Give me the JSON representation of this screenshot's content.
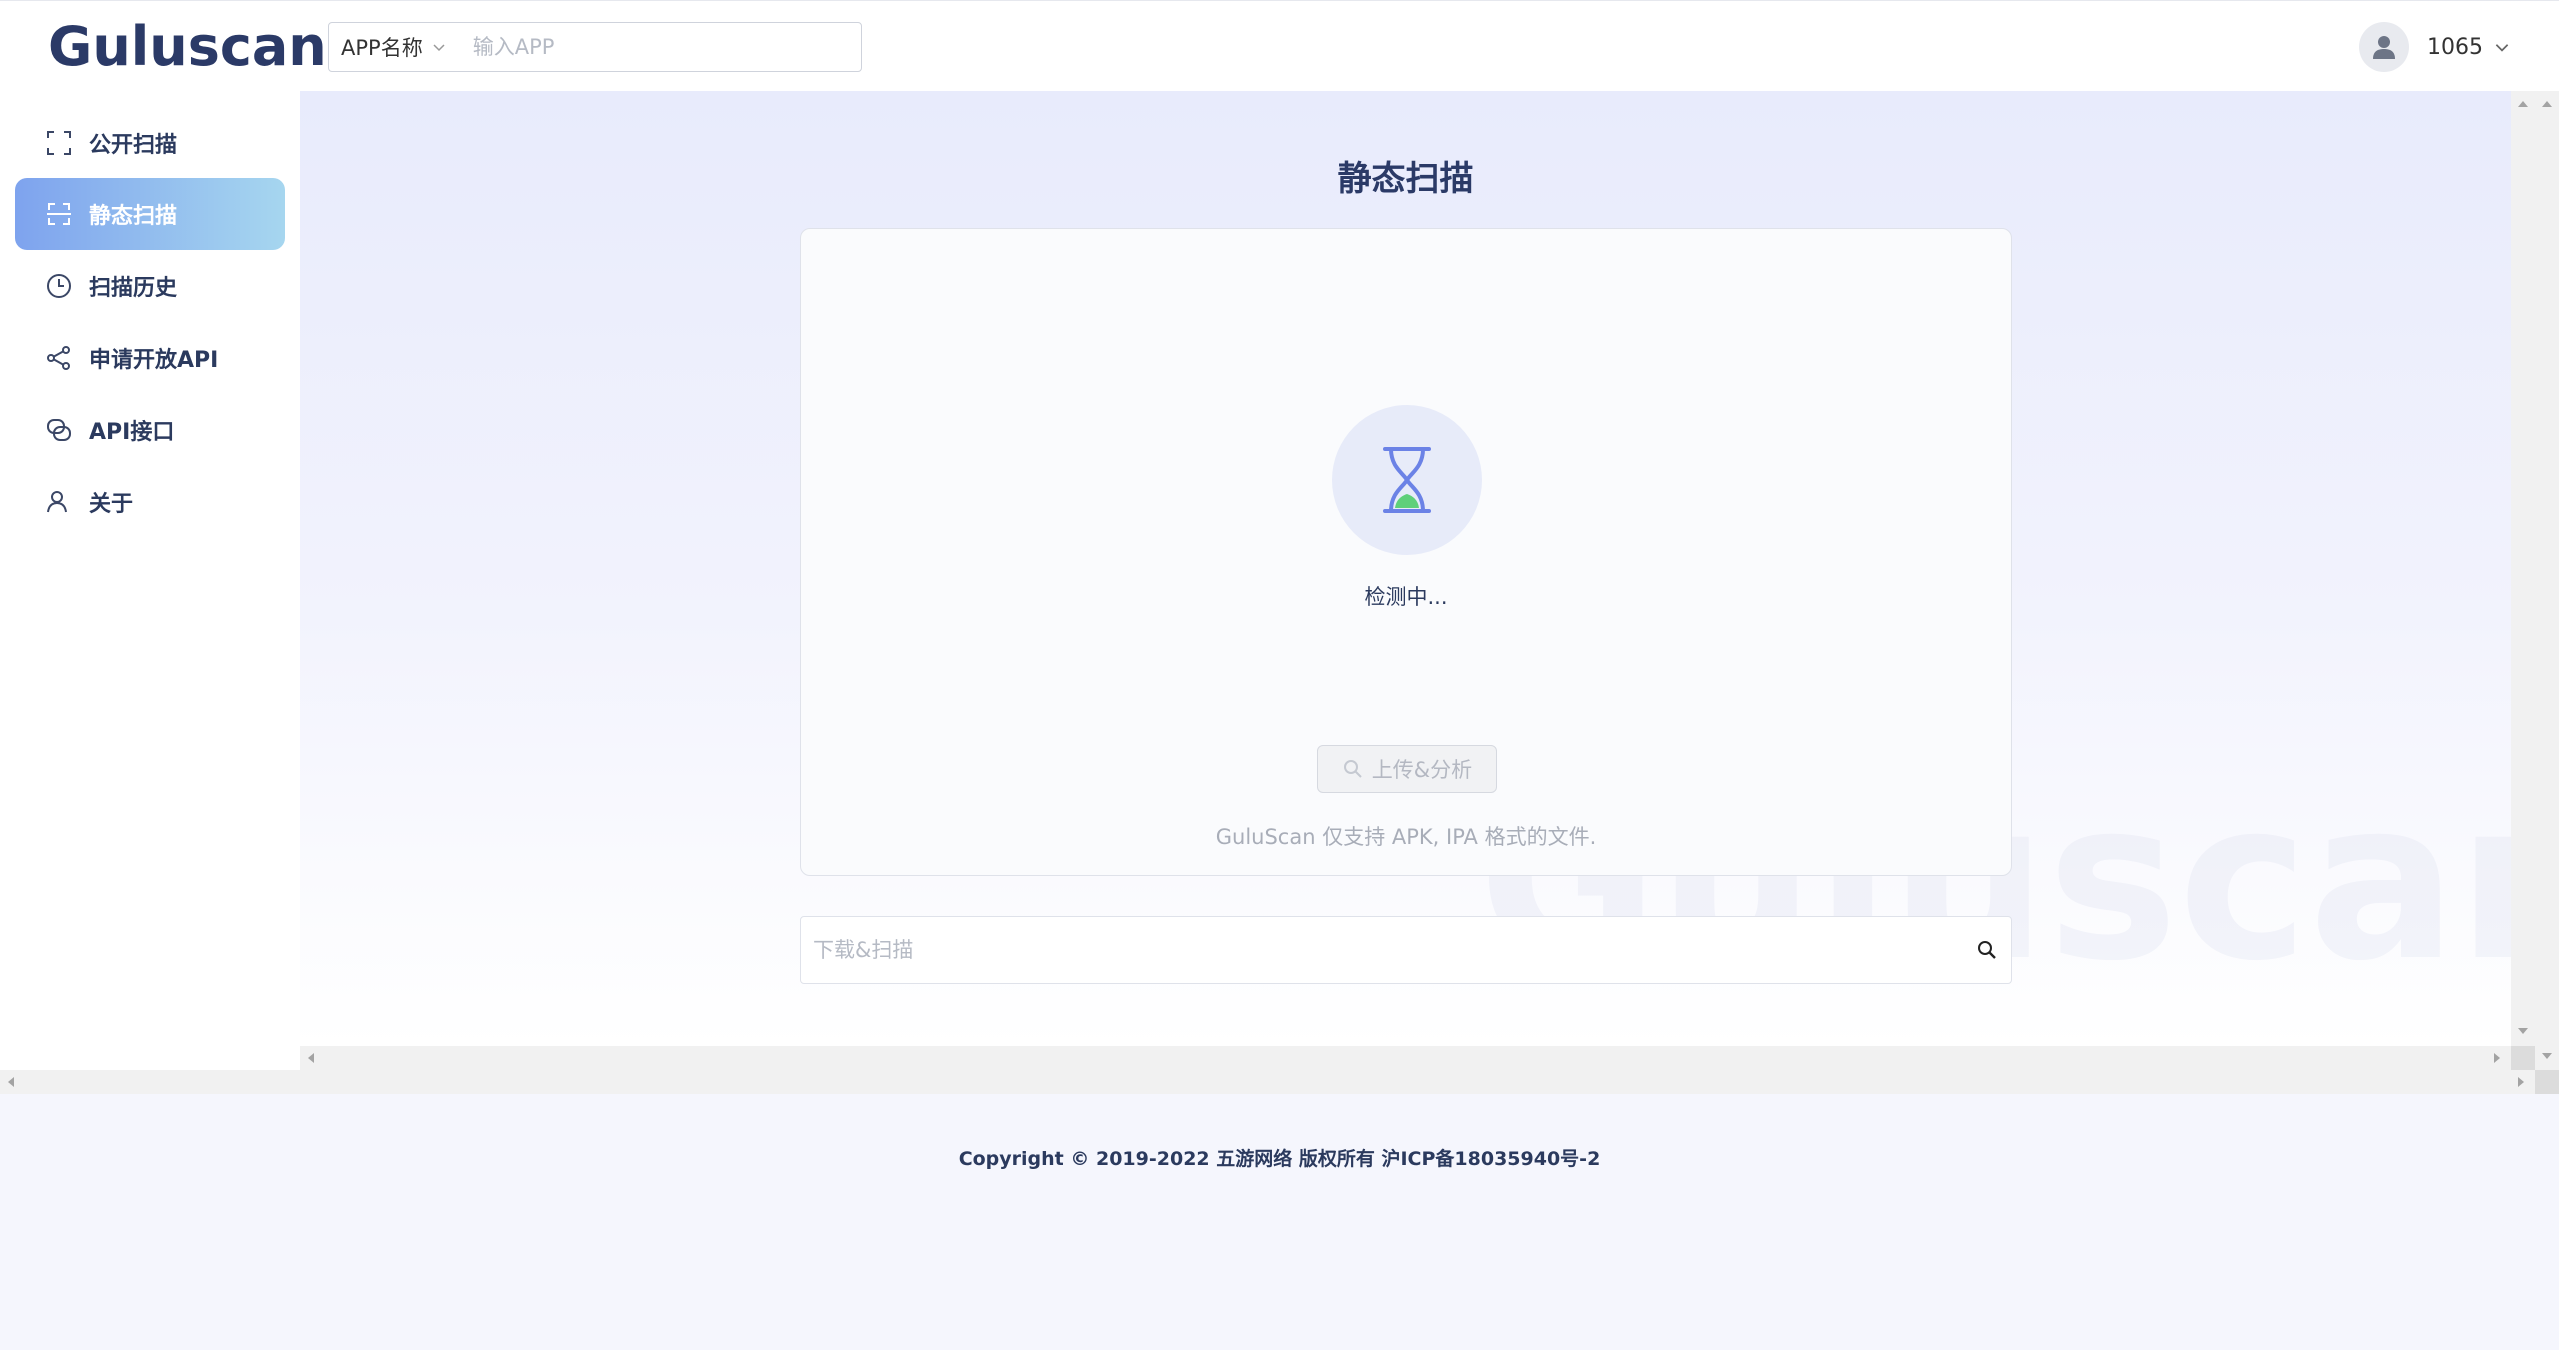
{
  "header": {
    "logo": "Guluscan",
    "search": {
      "type_label": "APP名称",
      "placeholder": "输入APP"
    },
    "user": {
      "name": "1065"
    }
  },
  "sidebar": {
    "items": [
      {
        "label": "公开扫描",
        "icon": "scan-frame-icon",
        "active": false
      },
      {
        "label": "静态扫描",
        "icon": "static-scan-icon",
        "active": true
      },
      {
        "label": "扫描历史",
        "icon": "clock-icon",
        "active": false
      },
      {
        "label": "申请开放API",
        "icon": "share-icon",
        "active": false
      },
      {
        "label": "API接口",
        "icon": "link-icon",
        "active": false
      },
      {
        "label": "关于",
        "icon": "user-icon",
        "active": false
      }
    ]
  },
  "main": {
    "title": "静态扫描",
    "watermark": "Guluscan",
    "status_text": "检测中...",
    "upload_button": "上传&分析",
    "support_text": "GuluScan 仅支持 APK, IPA 格式的文件.",
    "download_placeholder": "下载&扫描"
  },
  "footer": {
    "copyright": "Copyright © 2019-2022 五游网络 版权所有 沪ICP备18035940号-2"
  },
  "colors": {
    "brand": "#2b3a67",
    "active_start": "#7ea3ee",
    "active_end": "#a6d6ef",
    "hourglass": "#6b82e6",
    "sand": "#5fd07a"
  }
}
